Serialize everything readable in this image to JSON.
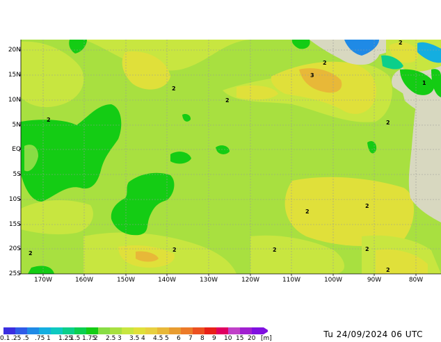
{
  "map": {
    "lat_labels": [
      "20N",
      "15N",
      "10N",
      "5N",
      "EQ",
      "5S",
      "10S",
      "15S",
      "20S",
      "25S"
    ],
    "lon_labels": [
      "170W",
      "160W",
      "150W",
      "140W",
      "130W",
      "120W",
      "110W",
      "100W",
      "90W",
      "80W"
    ],
    "contour_labels": [
      "2",
      "2",
      "2",
      "3",
      "2",
      "2",
      "1",
      "2",
      "2",
      "2",
      "2",
      "2",
      "2",
      "2",
      "2"
    ]
  },
  "colorbar": {
    "labels": [
      "0.1",
      ".25",
      ".5",
      ".75",
      "1",
      "1.25",
      "1.5",
      "1.75",
      "2",
      "2.5",
      "3",
      "3.5",
      "4",
      "4.5",
      "5",
      "6",
      "7",
      "8",
      "9",
      "10",
      "15",
      "20"
    ],
    "unit": "[m]",
    "colors": [
      "#3a2ee0",
      "#2f5be8",
      "#1f8ae6",
      "#14aee0",
      "#0dc9c0",
      "#0bcf8a",
      "#0bcf50",
      "#14cc14",
      "#88dd44",
      "#a8e040",
      "#c8e640",
      "#e0e03a",
      "#e8d040",
      "#e8b838",
      "#e89c30",
      "#ec7a28",
      "#ec5020",
      "#e82018",
      "#e00060",
      "#c040c8",
      "#a020d0",
      "#8010e0"
    ]
  },
  "timestamp": "Tu 24/09/2024 06 UTC"
}
